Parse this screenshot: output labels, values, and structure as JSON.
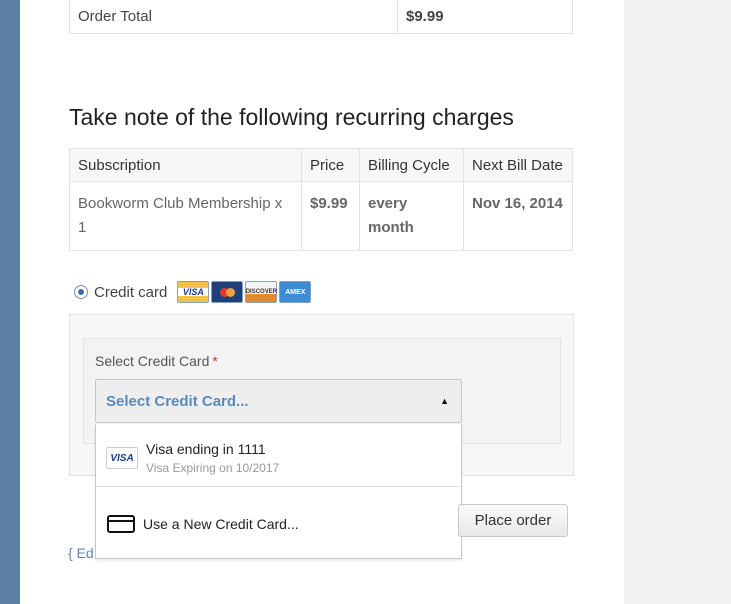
{
  "order_total": {
    "label": "Order Total",
    "value": "$9.99"
  },
  "recurring": {
    "title": "Take note of the following recurring charges",
    "headers": [
      "Subscription",
      "Price",
      "Billing Cycle",
      "Next Bill Date"
    ],
    "row": {
      "subscription": "Bookworm Club Membership x 1",
      "price": "$9.99",
      "cycle": "every month",
      "next_bill": "Nov 16, 2014"
    }
  },
  "payment": {
    "method_label": "Credit card",
    "card_logos": [
      "VISA",
      "MasterCard",
      "DISCOVER",
      "AMEX"
    ]
  },
  "card_select": {
    "label": "Select Credit Card",
    "required_mark": "*",
    "selected": "Select Credit Card...",
    "options": [
      {
        "title": "Visa ending in 1111",
        "subtitle": "Visa Expiring on 10/2017",
        "icon": "visa-card-icon",
        "icon_text": "VISA"
      },
      {
        "title": "Use a New Credit Card...",
        "icon": "credit-card-icon"
      }
    ]
  },
  "actions": {
    "place_order": "Place order",
    "edit_link": "{ Ed"
  },
  "colors": {
    "left_rail": "#5b7fa3",
    "link": "#5b89b8",
    "required": "#c0392b"
  }
}
